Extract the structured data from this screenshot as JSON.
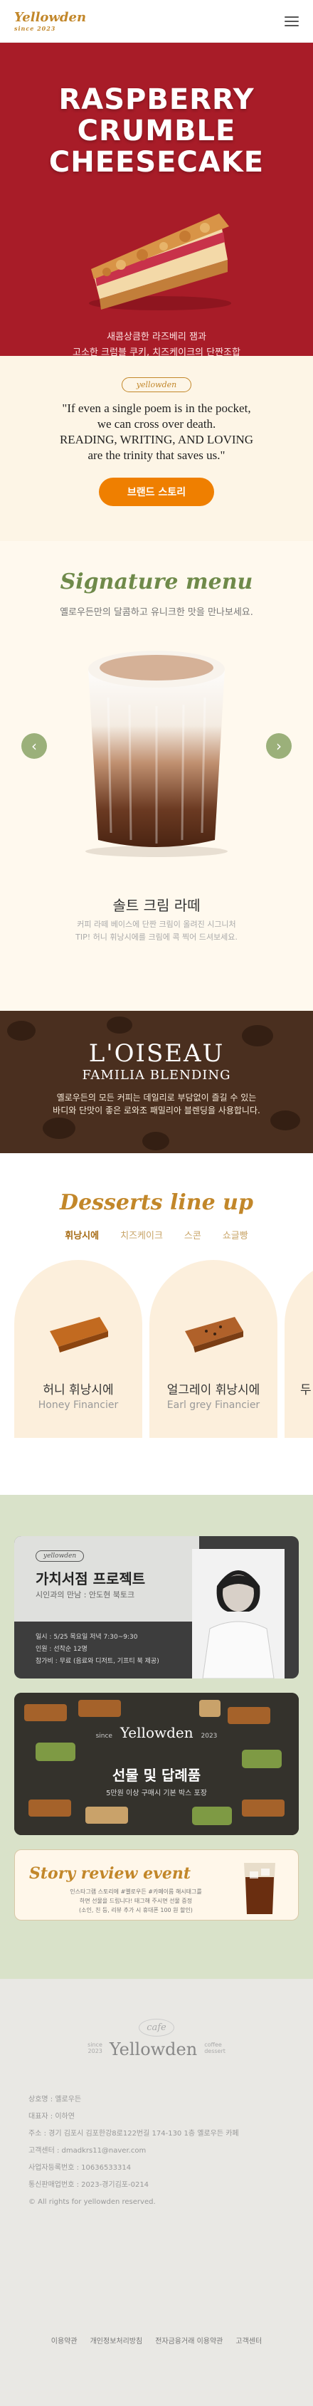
{
  "header": {
    "logo": "Yellowden",
    "logo_sub": "since 2023"
  },
  "hero": {
    "title_lines": [
      "RASPBERRY",
      "CRUMBLE",
      "CHEESECAKE"
    ],
    "sub1": "새콤상큼한 라즈베리 잼과",
    "sub2": "고소한 크럼블 쿠키, 치즈케이크의 단짠조합"
  },
  "quote": {
    "tag": "yellowden",
    "lines": [
      "\"If even a single poem is in the pocket,",
      "we can cross over death.",
      "READING, WRITING, AND LOVING",
      "are the trinity that saves us.\""
    ],
    "button": "브랜드 스토리"
  },
  "signature": {
    "title": "Signature menu",
    "desc": "옐로우든만의 달콤하고 유니크한 맛을 만나보세요.",
    "item_name": "솔트 크림 라떼",
    "item_desc1": "커피 라떼 베이스에 단짠 크림이 올려진 시그니처",
    "item_desc2": "TIP! 허니 휘낭시에를 크림에 콕 찍어 드셔보세요.",
    "prev": "‹",
    "next": "›"
  },
  "brand": {
    "title": "L'OISEAU",
    "subtitle": "FAMILIA BLENDING",
    "desc1": "옐로우든의 모든 커피는 데일리로 부담없이 즐길 수 있는",
    "desc2": "바디와 단맛이 좋은 로와조 패밀리아 블렌딩을 사용합니다."
  },
  "desserts": {
    "title": "Desserts line up",
    "tabs": [
      "휘낭시에",
      "치즈케이크",
      "스콘",
      "쇼글빵"
    ],
    "active_tab": "휘낭시에",
    "cards": [
      {
        "name": "허니 휘낭시에",
        "en": "Honey Financier"
      },
      {
        "name": "얼그레이 휘낭시에",
        "en": "Earl grey Financier"
      },
      {
        "name": "두",
        "en": ""
      }
    ]
  },
  "promo": {
    "p1": {
      "tag": "yellowden",
      "title": "가치서점 프로젝트",
      "sub": "시인과의 만남 : 안도현 북토크",
      "info": [
        "일시 : 5/25 목요일 저녁 7:30~9:30",
        "인원 : 선착순 12명",
        "참가비 : 무료 (음료와 디저트, 기프티 북 제공)"
      ]
    },
    "p2": {
      "logo": "Yellowden",
      "year_l": "since",
      "year_r": "2023",
      "title": "선물 및 답례품",
      "sub": "5만원 이상 구매시 기본 박스 포장"
    },
    "p3": {
      "title": "Story review event",
      "desc1": "인스타그램 스토리에 #옐로우든 #카페이름 해시태그를",
      "desc2": "하면 선물을 드립니다! 태그해 주시면 선물 증정",
      "desc3": "(소인, 친 등, 리뷰 추가 시 휴대폰 100 원 할인)"
    }
  },
  "footer": {
    "cafe": "cafe",
    "logo": "Yellowden",
    "since": "since",
    "year": "2023",
    "coffee": "coffee",
    "dessert": "dessert",
    "info": [
      "상호명 : 옐로우든",
      "대표자 : 이하연",
      "주소 : 경기 김포시 김포한강8로122번길 174-130 1층 옐로우든 카페",
      "고객센터 : dmadkrs11@naver.com",
      "사업자등록번호 : 10636533314",
      "통신판매업번호 : 2023-경기김포-0214",
      "© All rights for yellowden reserved."
    ],
    "links": [
      "이용약관",
      "개인정보처리방침",
      "전자금융거래 이용약관",
      "고객센터"
    ]
  }
}
